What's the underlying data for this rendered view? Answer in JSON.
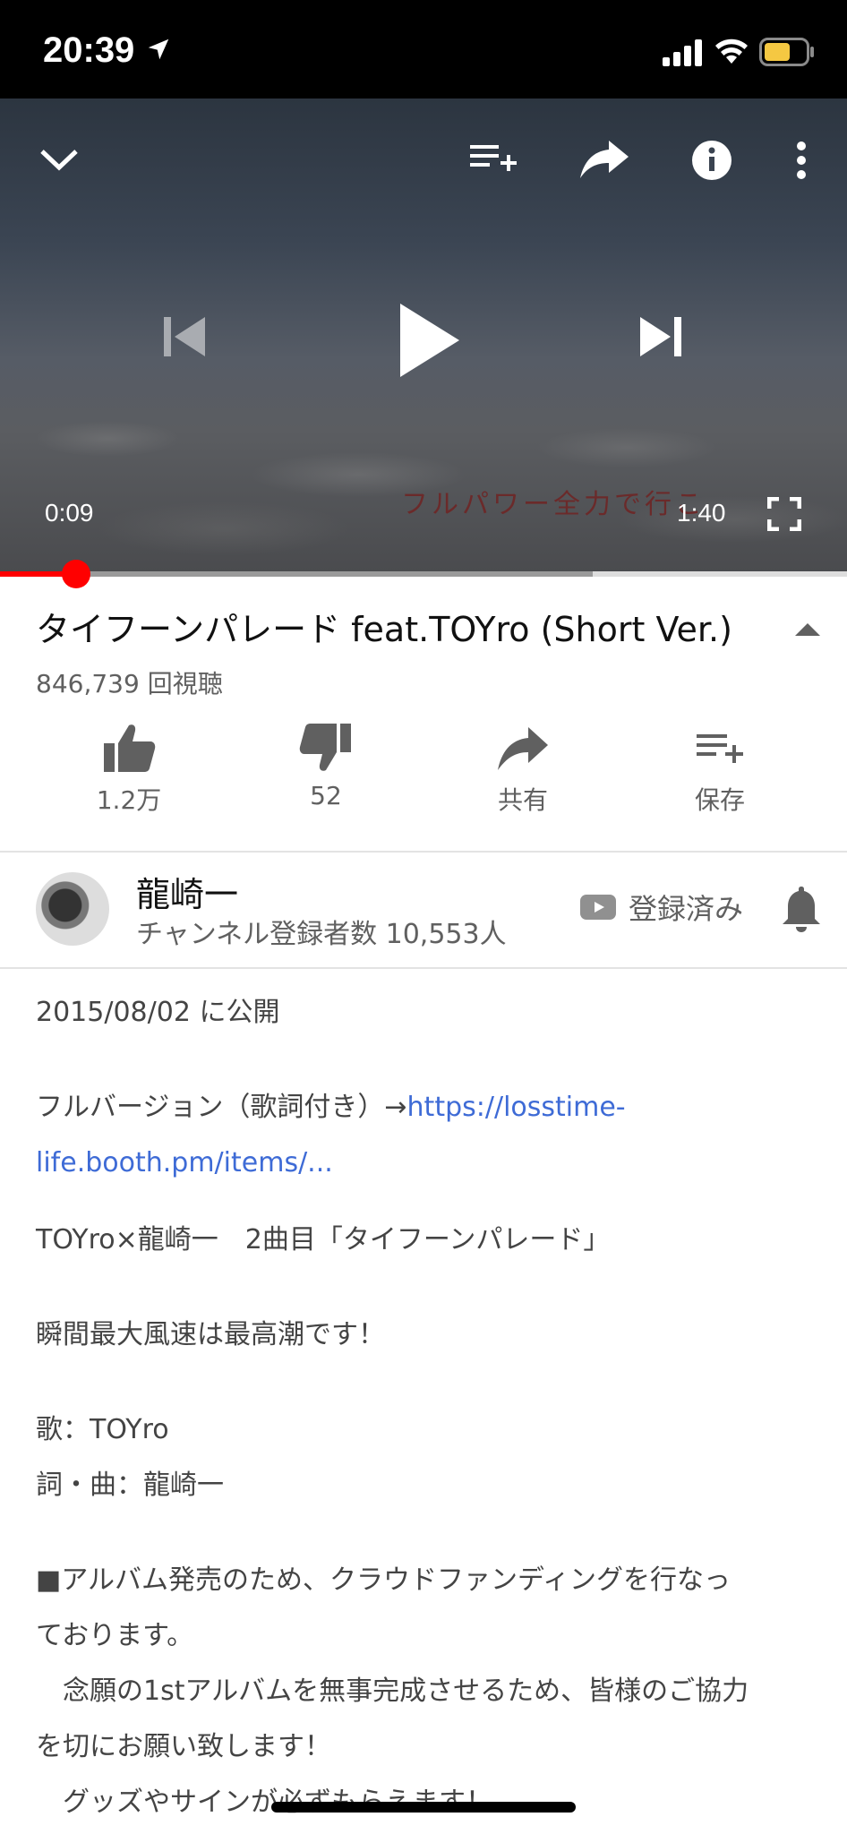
{
  "status_bar": {
    "time": "20:39"
  },
  "player": {
    "current_time": "0:09",
    "duration": "1:40",
    "overlay_text": "フルパワー全力で行こ",
    "progress_fraction": 0.09,
    "buffered_fraction": 0.7
  },
  "video": {
    "title": "タイフーンパレード feat.TOYro (Short Ver.)",
    "views": "846,739 回視聴"
  },
  "actions": {
    "like_count": "1.2万",
    "dislike_count": "52",
    "share_label": "共有",
    "save_label": "保存"
  },
  "channel": {
    "name": "龍崎一",
    "subscribers": "チャンネル登録者数 10,553人",
    "subscribed_label": "登録済み"
  },
  "description": {
    "published": "2015/08/02 に公開",
    "full_version_prefix": "フルバージョン（歌詞付き）→",
    "link_line1": "https://losstime-",
    "link_line2": "life.booth.pm/items/...",
    "line_collab": "TOYro×龍崎一　2曲目「タイフーンパレード」",
    "line_wind": "瞬間最大風速は最高潮です！",
    "line_vocal": "歌：TOYro",
    "line_lyrics": "詞・曲：龍崎一",
    "line_album1": "■アルバム発売のため、クラウドファンディングを行なっ",
    "line_album2": "ております。",
    "line_album3": "　念願の1stアルバムを無事完成させるため、皆様のご協力",
    "line_album4": "を切にお願い致します！",
    "line_album5": "　グッズやサインが必ずもらえます！"
  }
}
